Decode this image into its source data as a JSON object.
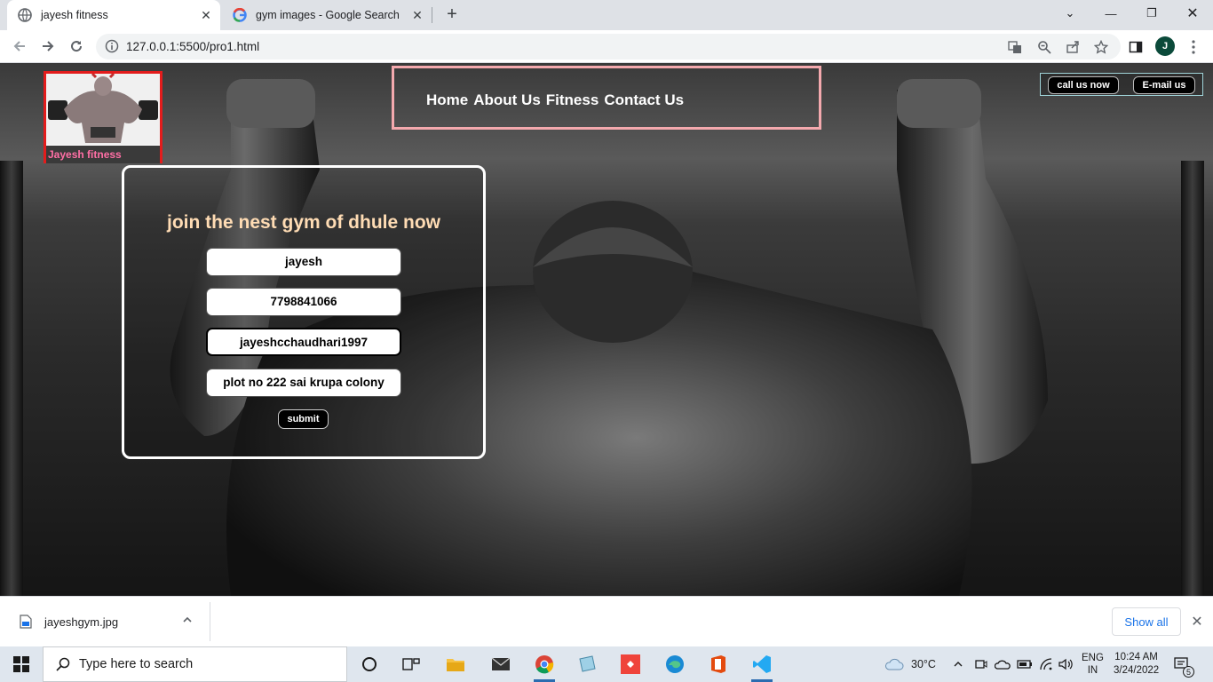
{
  "browser": {
    "tabs": [
      {
        "title": "jayesh fitness",
        "active": true
      },
      {
        "title": "gym images - Google Search",
        "active": false
      }
    ],
    "url": "127.0.0.1:5500/pro1.html",
    "profile_initial": "J"
  },
  "site": {
    "logo_caption": "Jayesh fitness",
    "nav": [
      "Home",
      "About Us",
      "Fitness",
      "Contact Us"
    ],
    "cta": {
      "call": "call us now",
      "email": "E-mail us"
    },
    "form": {
      "heading": "join the nest gym of dhule now",
      "fields": [
        "jayesh",
        "7798841066",
        "jayeshcchaudhari1997",
        "plot no 222 sai krupa colony"
      ],
      "submit": "submit"
    }
  },
  "download": {
    "filename": "jayeshgym.jpg",
    "show_all": "Show all"
  },
  "taskbar": {
    "search_placeholder": "Type here to search",
    "weather": "30°C",
    "lang_top": "ENG",
    "lang_bottom": "IN",
    "time": "10:24 AM",
    "date": "3/24/2022",
    "notification_count": "5"
  },
  "colors": {
    "logo_border": "#e31c1c",
    "nav_border": "#f4a9ae",
    "heading": "#ffdcb4",
    "caption": "#ff6fa5"
  }
}
